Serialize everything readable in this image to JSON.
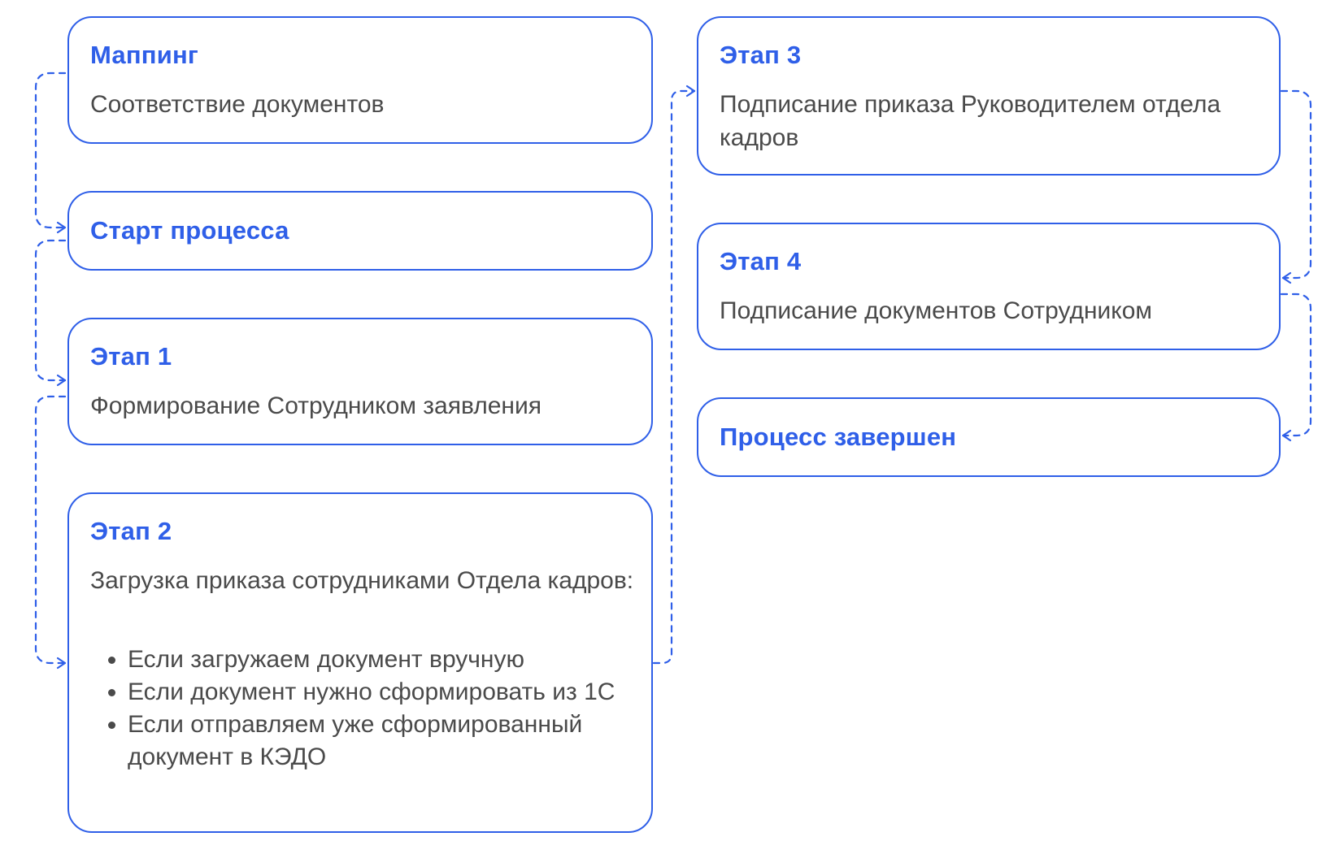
{
  "colors": {
    "accent": "#2f5fe8",
    "text": "#4a4a4a",
    "background": "#ffffff"
  },
  "steps": {
    "mapping": {
      "title": "Маппинг",
      "description": "Соответствие документов"
    },
    "start": {
      "title": "Старт процесса"
    },
    "stage1": {
      "title": "Этап 1",
      "description": "Формирование Сотрудником заявления"
    },
    "stage2": {
      "title": "Этап 2",
      "description": "Загрузка приказа сотрудниками Отдела кадров:",
      "bullets": [
        "Если загружаем документ вручную",
        "Если документ нужно сформировать из 1С",
        "Если отправляем уже сформированный документ в КЭДО"
      ]
    },
    "stage3": {
      "title": "Этап 3",
      "description": "Подписание приказа Руководителем отдела кадров"
    },
    "stage4": {
      "title": "Этап 4",
      "description": "Подписание документов Сотрудником"
    },
    "finish": {
      "title": "Процесс завершен"
    }
  }
}
